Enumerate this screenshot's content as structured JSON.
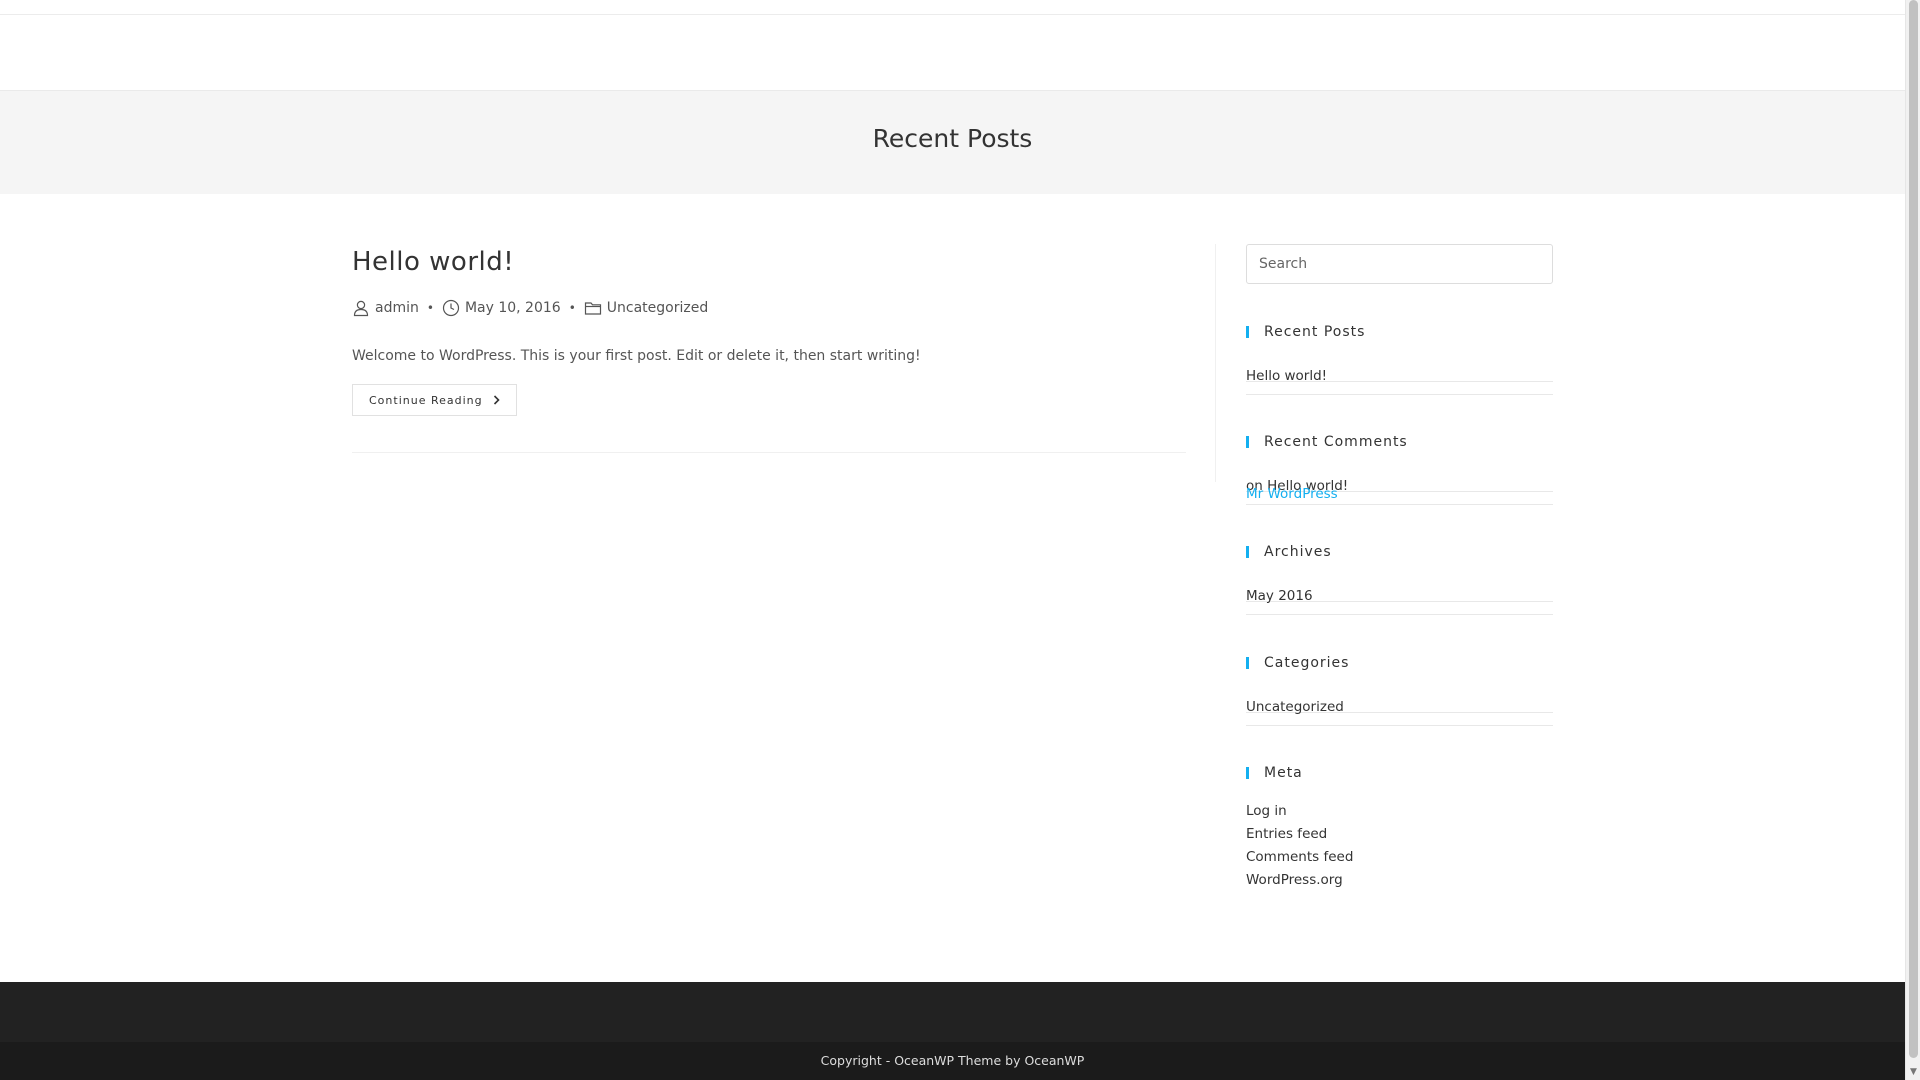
{
  "page": {
    "title": "Recent Posts"
  },
  "post": {
    "title": "Hello world!",
    "author": "admin",
    "date": "May 10, 2016",
    "category": "Uncategorized",
    "excerpt": "Welcome to WordPress. This is your first post. Edit or delete it, then start writing!",
    "continue_label": "Continue Reading"
  },
  "sidebar": {
    "search_placeholder": "Search",
    "recent_posts": {
      "title": "Recent Posts",
      "items": [
        "Hello world!"
      ]
    },
    "recent_comments": {
      "title": "Recent Comments",
      "author": "Mr WordPress",
      "on": "on",
      "post": "Hello world!"
    },
    "archives": {
      "title": "Archives",
      "items": [
        "May 2016"
      ]
    },
    "categories": {
      "title": "Categories",
      "items": [
        "Uncategorized"
      ]
    },
    "meta": {
      "title": "Meta",
      "items": [
        "Log in",
        "Entries feed",
        "Comments feed",
        "WordPress.org"
      ]
    }
  },
  "footer": {
    "copyright": "Copyright - OceanWP Theme by OceanWP"
  },
  "colors": {
    "accent": "#13aff0",
    "footer_bg": "#222222",
    "page_header_bg": "#f5f5f5"
  },
  "icons": {
    "author": "user-icon",
    "date": "clock-icon",
    "category": "folder-icon",
    "continue": "chevron-right-icon"
  }
}
